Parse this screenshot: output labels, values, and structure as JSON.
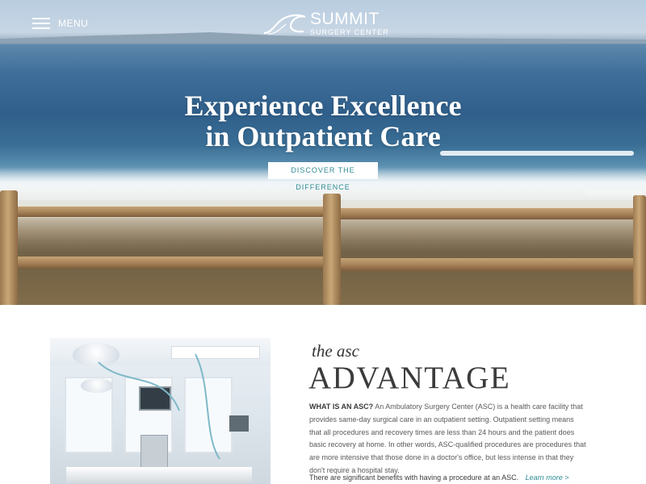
{
  "header": {
    "menu_label": "MENU",
    "logo_name": "SUMMIT",
    "logo_sub": "SURGERY CENTER"
  },
  "hero": {
    "title_line1": "Experience Excellence",
    "title_line2": "in Outpatient Care",
    "cta_label": "DISCOVER THE DIFFERENCE"
  },
  "advantage": {
    "eyebrow": "the asc",
    "title": "ADVANTAGE",
    "lead_label": "WHAT IS AN ASC?",
    "body": "An Ambulatory Surgery Center (ASC) is a health care facility that provides same-day surgical care in an outpatient setting. Outpatient setting means that all procedures and recovery times are less than 24 hours and the patient does basic recovery at home. In other words, ASC-qualified procedures are procedures that are more intensive that those done in a doctor's office, but less intense in that they don't require a hospital stay.",
    "benefits_text": "There are significant benefits with having a procedure at an ASC.",
    "learn_more": "Learn more >"
  },
  "icons": {
    "menu": "hamburger-icon",
    "logo": "wave-logo-icon"
  },
  "colors": {
    "accent": "#2f8a94",
    "heading": "#3b3b3b",
    "body_text": "#5a5a5a"
  }
}
